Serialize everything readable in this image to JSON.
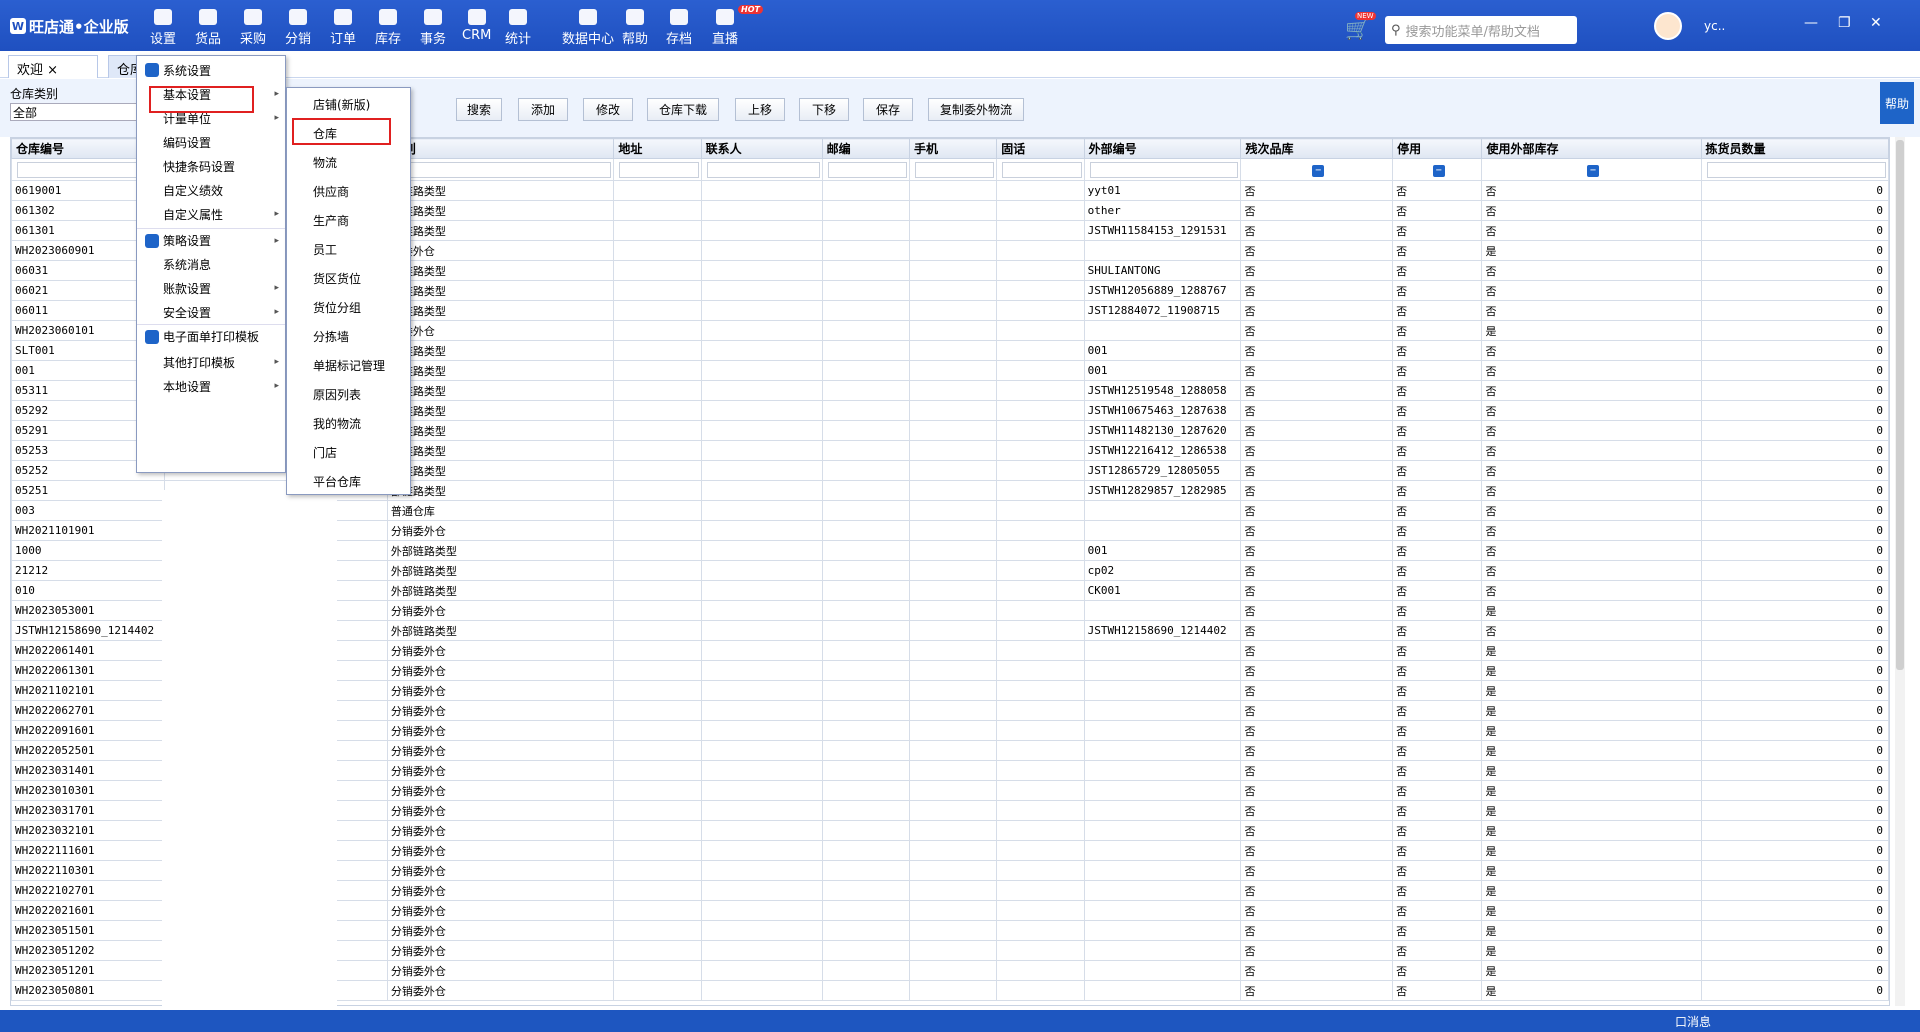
{
  "app": {
    "logo": "旺店通•企业版",
    "logo_mark": "W"
  },
  "nav": [
    {
      "label": "设置",
      "icon": "gear-icon"
    },
    {
      "label": "货品",
      "icon": "box-icon"
    },
    {
      "label": "采购",
      "icon": "cart-icon"
    },
    {
      "label": "分销",
      "icon": "chart-icon"
    },
    {
      "label": "订单",
      "icon": "calendar-icon"
    },
    {
      "label": "库存",
      "icon": "grid-icon"
    },
    {
      "label": "事务",
      "icon": "chat-icon"
    },
    {
      "label": "CRM",
      "icon": "user-icon"
    },
    {
      "label": "统计",
      "icon": "pie-icon"
    },
    {
      "label": "数据中心",
      "icon": "bar-icon"
    },
    {
      "label": "帮助",
      "icon": "help-icon"
    },
    {
      "label": "存档",
      "icon": "archive-icon"
    },
    {
      "label": "直播",
      "icon": "video-icon",
      "badge": "HOT"
    }
  ],
  "header": {
    "search_placeholder": "搜索功能菜单/帮助文档",
    "cart_badge": "NEW",
    "username": "yc.."
  },
  "tabs": [
    {
      "label": "欢迎",
      "close": "×"
    },
    {
      "label": "仓库"
    }
  ],
  "filter": {
    "category_label": "仓库类别",
    "category_value": "全部"
  },
  "toolbar": {
    "search": "搜索",
    "add": "添加",
    "edit": "修改",
    "download": "仓库下载",
    "up": "上移",
    "down": "下移",
    "save": "保存",
    "copy": "复制委外物流",
    "help": "帮助"
  },
  "columns": [
    "仓库编号",
    "",
    "类别",
    "地址",
    "联系人",
    "邮编",
    "手机",
    "固话",
    "外部编号",
    "残次品库",
    "停用",
    "使用外部库存",
    "拣货员数量"
  ],
  "rows": [
    [
      "0619001",
      "",
      "部链路类型",
      "",
      "",
      "",
      "",
      "",
      "yyt01",
      "否",
      "否",
      "否",
      "0"
    ],
    [
      "061302",
      "",
      "部链路类型",
      "",
      "",
      "",
      "",
      "",
      "other",
      "否",
      "否",
      "否",
      "0"
    ],
    [
      "061301",
      "",
      "部链路类型",
      "",
      "",
      "",
      "",
      "",
      "JSTWH11584153_1291531",
      "否",
      "否",
      "否",
      "0"
    ],
    [
      "WH2023060901",
      "",
      "销委外仓",
      "",
      "",
      "",
      "",
      "",
      "",
      "否",
      "否",
      "是",
      "0"
    ],
    [
      "06031",
      "",
      "部链路类型",
      "",
      "",
      "",
      "",
      "",
      "SHULIANTONG",
      "否",
      "否",
      "否",
      "0"
    ],
    [
      "06021",
      "",
      "部链路类型",
      "",
      "",
      "",
      "",
      "",
      "JSTWH12056889_1288767",
      "否",
      "否",
      "否",
      "0"
    ],
    [
      "06011",
      "",
      "部链路类型",
      "",
      "",
      "",
      "",
      "",
      "JST12884072_11908715",
      "否",
      "否",
      "否",
      "0"
    ],
    [
      "WH2023060101",
      "",
      "销委外仓",
      "",
      "",
      "",
      "",
      "",
      "",
      "否",
      "否",
      "是",
      "0"
    ],
    [
      "SLT001",
      "",
      "部链路类型",
      "",
      "",
      "",
      "",
      "",
      "001",
      "否",
      "否",
      "否",
      "0"
    ],
    [
      "001",
      "",
      "部链路类型",
      "",
      "",
      "",
      "",
      "",
      "001",
      "否",
      "否",
      "否",
      "0"
    ],
    [
      "05311",
      "",
      "部链路类型",
      "",
      "",
      "",
      "",
      "",
      "JSTWH12519548_1288058",
      "否",
      "否",
      "否",
      "0"
    ],
    [
      "05292",
      "",
      "部链路类型",
      "",
      "",
      "",
      "",
      "",
      "JSTWH10675463_1287638",
      "否",
      "否",
      "否",
      "0"
    ],
    [
      "05291",
      "",
      "部链路类型",
      "",
      "",
      "",
      "",
      "",
      "JSTWH11482130_1287620",
      "否",
      "否",
      "否",
      "0"
    ],
    [
      "05253",
      "",
      "部链路类型",
      "",
      "",
      "",
      "",
      "",
      "JSTWH12216412_1286538",
      "否",
      "否",
      "否",
      "0"
    ],
    [
      "05252",
      "",
      "部链路类型",
      "",
      "",
      "",
      "",
      "",
      "JST12865729_12805055",
      "否",
      "否",
      "否",
      "0"
    ],
    [
      "05251",
      "",
      "部链路类型",
      "",
      "",
      "",
      "",
      "",
      "JSTWH12829857_1282985",
      "否",
      "否",
      "否",
      "0"
    ],
    [
      "003",
      "",
      "普通仓库",
      "",
      "",
      "",
      "",
      "",
      "",
      "否",
      "否",
      "否",
      "0"
    ],
    [
      "WH2021101901",
      "",
      "分销委外仓",
      "",
      "",
      "",
      "",
      "",
      "",
      "否",
      "否",
      "否",
      "0"
    ],
    [
      "1000",
      "",
      "外部链路类型",
      "",
      "",
      "",
      "",
      "",
      "001",
      "否",
      "否",
      "否",
      "0"
    ],
    [
      "21212",
      "",
      "外部链路类型",
      "",
      "",
      "",
      "",
      "",
      "cp02",
      "否",
      "否",
      "否",
      "0"
    ],
    [
      "010",
      "",
      "外部链路类型",
      "",
      "",
      "",
      "",
      "",
      "CK001",
      "否",
      "否",
      "否",
      "0"
    ],
    [
      "WH2023053001",
      "",
      "分销委外仓",
      "",
      "",
      "",
      "",
      "",
      "",
      "否",
      "否",
      "是",
      "0"
    ],
    [
      "JSTWH12158690_1214402",
      "",
      "外部链路类型",
      "",
      "",
      "",
      "",
      "",
      "JSTWH12158690_1214402",
      "否",
      "否",
      "否",
      "0"
    ],
    [
      "WH2022061401",
      "",
      "分销委外仓",
      "",
      "",
      "",
      "",
      "",
      "",
      "否",
      "否",
      "是",
      "0"
    ],
    [
      "WH2022061301",
      "",
      "分销委外仓",
      "",
      "",
      "",
      "",
      "",
      "",
      "否",
      "否",
      "是",
      "0"
    ],
    [
      "WH2021102101",
      "",
      "分销委外仓",
      "",
      "",
      "",
      "",
      "",
      "",
      "否",
      "否",
      "是",
      "0"
    ],
    [
      "WH2022062701",
      "",
      "分销委外仓",
      "",
      "",
      "",
      "",
      "",
      "",
      "否",
      "否",
      "是",
      "0"
    ],
    [
      "WH2022091601",
      "",
      "分销委外仓",
      "",
      "",
      "",
      "",
      "",
      "",
      "否",
      "否",
      "是",
      "0"
    ],
    [
      "WH2022052501",
      "",
      "分销委外仓",
      "",
      "",
      "",
      "",
      "",
      "",
      "否",
      "否",
      "是",
      "0"
    ],
    [
      "WH2023031401",
      "",
      "分销委外仓",
      "",
      "",
      "",
      "",
      "",
      "",
      "否",
      "否",
      "是",
      "0"
    ],
    [
      "WH2023010301",
      "",
      "分销委外仓",
      "",
      "",
      "",
      "",
      "",
      "",
      "否",
      "否",
      "是",
      "0"
    ],
    [
      "WH2023031701",
      "",
      "分销委外仓",
      "",
      "",
      "",
      "",
      "",
      "",
      "否",
      "否",
      "是",
      "0"
    ],
    [
      "WH2023032101",
      "",
      "分销委外仓",
      "",
      "",
      "",
      "",
      "",
      "",
      "否",
      "否",
      "是",
      "0"
    ],
    [
      "WH2022111601",
      "",
      "分销委外仓",
      "",
      "",
      "",
      "",
      "",
      "",
      "否",
      "否",
      "是",
      "0"
    ],
    [
      "WH2022110301",
      "",
      "分销委外仓",
      "",
      "",
      "",
      "",
      "",
      "",
      "否",
      "否",
      "是",
      "0"
    ],
    [
      "WH2022102701",
      "",
      "分销委外仓",
      "",
      "",
      "",
      "",
      "",
      "",
      "否",
      "否",
      "是",
      "0"
    ],
    [
      "WH2022021601",
      "",
      "分销委外仓",
      "",
      "",
      "",
      "",
      "",
      "",
      "否",
      "否",
      "是",
      "0"
    ],
    [
      "WH2023051501",
      "",
      "分销委外仓",
      "",
      "",
      "",
      "",
      "",
      "",
      "否",
      "否",
      "是",
      "0"
    ],
    [
      "WH2023051202",
      "",
      "分销委外仓",
      "",
      "",
      "",
      "",
      "",
      "",
      "否",
      "否",
      "是",
      "0"
    ],
    [
      "WH2023051201",
      "",
      "分销委外仓",
      "",
      "",
      "",
      "",
      "",
      "",
      "否",
      "否",
      "是",
      "0"
    ],
    [
      "WH2023050801",
      "",
      "分销委外仓",
      "",
      "",
      "",
      "",
      "",
      "",
      "否",
      "否",
      "是",
      "0"
    ]
  ],
  "menu1": [
    {
      "label": "系统设置",
      "icon": "gear-icon"
    },
    {
      "label": "基本设置",
      "arrow": "▸"
    },
    {
      "label": "计量单位",
      "arrow": "▸"
    },
    {
      "label": "编码设置"
    },
    {
      "label": "快捷条码设置"
    },
    {
      "label": "自定义绩效"
    },
    {
      "label": "自定义属性",
      "arrow": "▸"
    },
    {
      "label": "策略设置",
      "icon": "layers-icon",
      "arrow": "▸"
    },
    {
      "label": "系统消息"
    },
    {
      "label": "账款设置",
      "arrow": "▸"
    },
    {
      "label": "安全设置",
      "arrow": "▸"
    },
    {
      "label": "电子面单打印模板",
      "icon": "printer-icon"
    },
    {
      "label": "其他打印模板",
      "arrow": "▸"
    },
    {
      "label": "本地设置",
      "arrow": "▸"
    }
  ],
  "menu2": [
    "店铺(新版)",
    "仓库",
    "物流",
    "供应商",
    "生产商",
    "员工",
    "货区货位",
    "货位分组",
    "分拣墙",
    "单据标记管理",
    "原因列表",
    "我的物流",
    "门店",
    "平台仓库"
  ],
  "status": {
    "message": "口消息"
  },
  "colors": {
    "primary": "#1f50c0",
    "highlight": "#e02020"
  }
}
